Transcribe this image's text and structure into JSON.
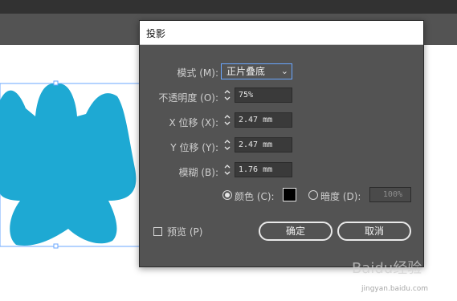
{
  "dialog": {
    "title": "投影",
    "mode_label": "模式 (M):",
    "mode_value": "正片叠底",
    "opacity_label": "不透明度 (O):",
    "opacity_value": "75%",
    "x_offset_label": "X 位移 (X):",
    "x_offset_value": "2.47 mm",
    "y_offset_label": "Y 位移 (Y):",
    "y_offset_value": "2.47 mm",
    "blur_label": "模糊 (B):",
    "blur_value": "1.76 mm",
    "color_option_label": "颜色 (C):",
    "darkness_option_label": "暗度 (D):",
    "darkness_value": "100%",
    "preview_label": "预览 (P)",
    "ok_label": "确定",
    "cancel_label": "取消"
  },
  "colors": {
    "shape_fill": "#1ea9d3",
    "shadow_color": "#000000",
    "selection_accent": "#6aa7ff"
  },
  "watermark": {
    "brand": "Baidu经验",
    "url": "jingyan.baidu.com"
  }
}
